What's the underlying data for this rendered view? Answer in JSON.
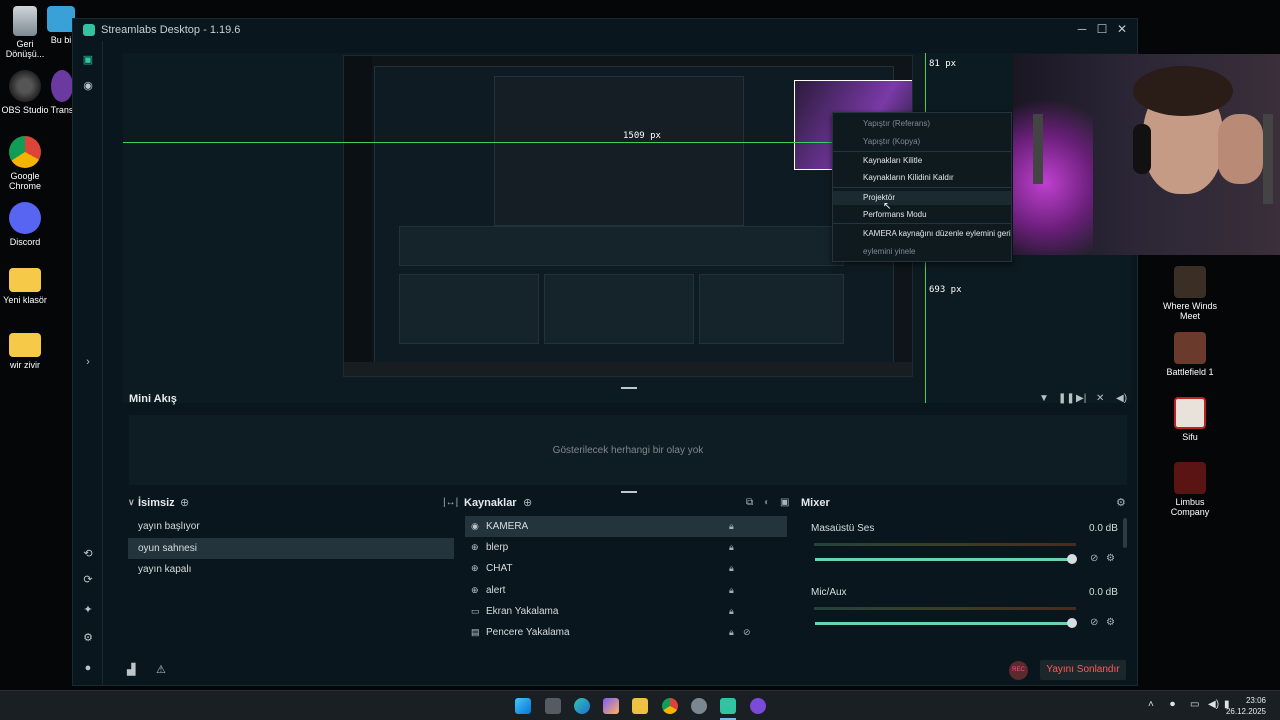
{
  "desktop": {
    "left_icons": [
      {
        "label": "Geri\nDönüşü...",
        "name": "recycle-bin"
      },
      {
        "label": "Bu bi",
        "name": "this-pc"
      },
      {
        "label": "OBS Studio",
        "name": "obs-studio"
      },
      {
        "label": "Trans",
        "name": "trans"
      },
      {
        "label": "Google\nChrome",
        "name": "google-chrome"
      },
      {
        "label": "Discord",
        "name": "discord"
      },
      {
        "label": "Yeni klasör",
        "name": "new-folder"
      },
      {
        "label": "wir zivir",
        "name": "wir-zivir-folder"
      }
    ],
    "right_icons": [
      {
        "label": "Where Winds\nMeet",
        "name": "where-winds-meet"
      },
      {
        "label": "Battlefield 1",
        "name": "battlefield-1"
      },
      {
        "label": "Sifu",
        "name": "sifu"
      },
      {
        "label": "Limbus\nCompany",
        "name": "limbus-company"
      }
    ]
  },
  "window": {
    "title": "Streamlabs Desktop - 1.19.6",
    "minimize": "─",
    "maximize": "☐",
    "close": "✕"
  },
  "preview": {
    "width_readout": "81 px",
    "left_readout": "1509 px",
    "bottom_readout": "693 px"
  },
  "context_menu": {
    "items": [
      {
        "label": "Yapıştır (Referans)",
        "state": "disabled"
      },
      {
        "label": "Yapıştır (Kopya)",
        "state": "disabled"
      },
      {
        "label": "Kaynakları Kilitle",
        "state": "normal"
      },
      {
        "label": "Kaynakların Kilidini Kaldır",
        "state": "normal"
      },
      {
        "label": "Projektör",
        "state": "hover"
      },
      {
        "label": "Performans Modu",
        "state": "normal"
      },
      {
        "label": "KAMERA kaynağını düzenle eylemini geri al",
        "state": "normal"
      },
      {
        "label": "eylemini yinele",
        "state": "disabled"
      }
    ]
  },
  "mini_feed": {
    "title": "Mini Akış",
    "empty_text": "Gösterilecek herhangi bir olay yok"
  },
  "scenes": {
    "title": "İsimsiz",
    "items": [
      {
        "label": "yayın başlıyor",
        "active": false
      },
      {
        "label": "oyun sahnesi",
        "active": true
      },
      {
        "label": "yayın kapalı",
        "active": false
      }
    ]
  },
  "sources": {
    "title": "Kaynaklar",
    "items": [
      {
        "label": "KAMERA",
        "icon": "webcam-icon",
        "active": true
      },
      {
        "label": "blerp",
        "icon": "globe-icon",
        "active": false
      },
      {
        "label": "CHAT",
        "icon": "globe-icon",
        "active": false
      },
      {
        "label": "alert",
        "icon": "globe-icon",
        "active": false
      },
      {
        "label": "Ekran Yakalama",
        "icon": "monitor-icon",
        "active": false
      },
      {
        "label": "Pencere Yakalama",
        "icon": "window-icon",
        "active": false
      }
    ]
  },
  "mixer": {
    "title": "Mixer",
    "channels": [
      {
        "name": "Masaüstü Ses",
        "db": "0.0 dB",
        "level": 1.0
      },
      {
        "name": "Mic/Aux",
        "db": "0.0 dB",
        "level": 1.0
      }
    ]
  },
  "footer": {
    "rec_label": "REC",
    "end_stream": "Yayını Sonlandır"
  },
  "taskbar": {
    "time": "23:06",
    "date": "26.12.2025"
  },
  "colors": {
    "accent": "#31c3a2",
    "window_bg": "#09161d",
    "selected_row": "#24343c",
    "end_stream_text": "#ff5a5a",
    "guide_green": "#3fd05a"
  }
}
